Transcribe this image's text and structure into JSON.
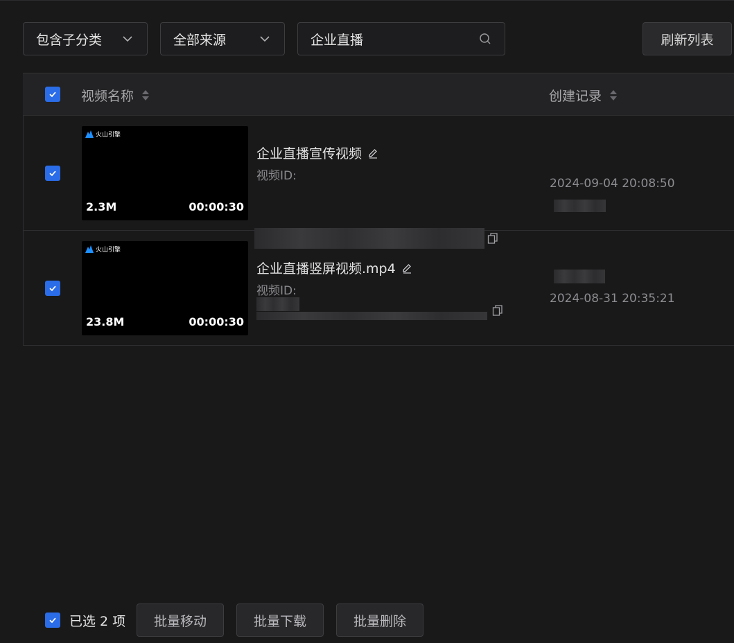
{
  "toolbar": {
    "category_filter": "包含子分类",
    "source_filter": "全部来源",
    "search_value": "企业直播",
    "refresh_label": "刷新列表"
  },
  "table": {
    "columns": [
      "视频名称",
      "创建记录"
    ],
    "rows": [
      {
        "title": "企业直播宣传视频",
        "id_label": "视频ID:",
        "size": "2.3M",
        "duration": "00:00:30",
        "created": "2024-09-04 20:08:50",
        "brand": "火山引擎",
        "checked": true
      },
      {
        "title": "企业直播竖屏视频.mp4",
        "id_label": "视频ID:",
        "size": "23.8M",
        "duration": "00:00:30",
        "created": "2024-08-31 20:35:21",
        "brand": "火山引擎",
        "checked": true
      }
    ]
  },
  "footer": {
    "selected_text": "已选 2 项",
    "move_label": "批量移动",
    "download_label": "批量下载",
    "delete_label": "批量删除"
  },
  "colors": {
    "background": "#19191a",
    "checkbox": "#2b6de8",
    "brand_blue": "#1e90ff"
  }
}
